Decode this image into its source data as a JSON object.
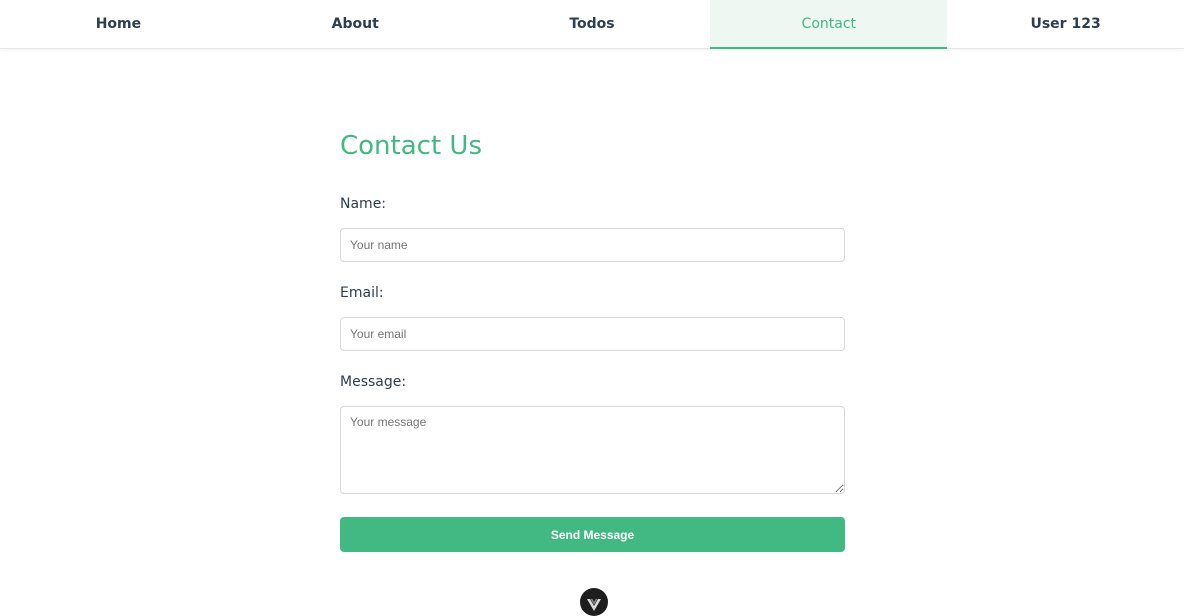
{
  "nav": {
    "items": [
      {
        "label": "Home"
      },
      {
        "label": "About"
      },
      {
        "label": "Todos"
      },
      {
        "label": "Contact",
        "active": true
      },
      {
        "label": "User 123"
      }
    ],
    "accent_color": "#42b883"
  },
  "contact": {
    "title": "Contact Us",
    "name": {
      "label": "Name:",
      "placeholder": "Your name",
      "value": ""
    },
    "email": {
      "label": "Email:",
      "placeholder": "Your email",
      "value": ""
    },
    "message": {
      "label": "Message:",
      "placeholder": "Your message",
      "value": ""
    },
    "submit_label": "Send Message"
  },
  "devtools": {
    "icon": "vue-logo-icon"
  }
}
